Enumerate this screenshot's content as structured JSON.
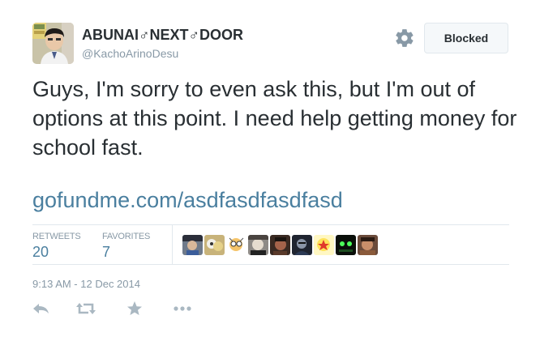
{
  "user": {
    "display_name": "ABUNAI♂NEXT♂DOOR",
    "handle": "@KachoArinoDesu",
    "avatar_icon": "user-avatar-photo"
  },
  "header": {
    "gear_icon": "gear-icon",
    "blocked_label": "Blocked"
  },
  "tweet": {
    "text": "Guys, I'm sorry to even ask this, but I'm out of options at this point. I need help getting money for school fast.",
    "link": "gofundme.com/asdfasdfasdfasd"
  },
  "stats": {
    "retweets_label": "RETWEETS",
    "retweets_value": "20",
    "favorites_label": "FAVORITES",
    "favorites_value": "7",
    "favoriter_avatar_count": 9
  },
  "timestamp": "9:13 AM - 12 Dec 2014",
  "actions": {
    "reply_icon": "reply-icon",
    "retweet_icon": "retweet-icon",
    "favorite_icon": "star-icon",
    "more_icon": "more-dots-icon"
  },
  "colors": {
    "text": "#292f33",
    "muted": "#8899a6",
    "link": "#4a7f9f",
    "border": "#e1e8ed"
  }
}
